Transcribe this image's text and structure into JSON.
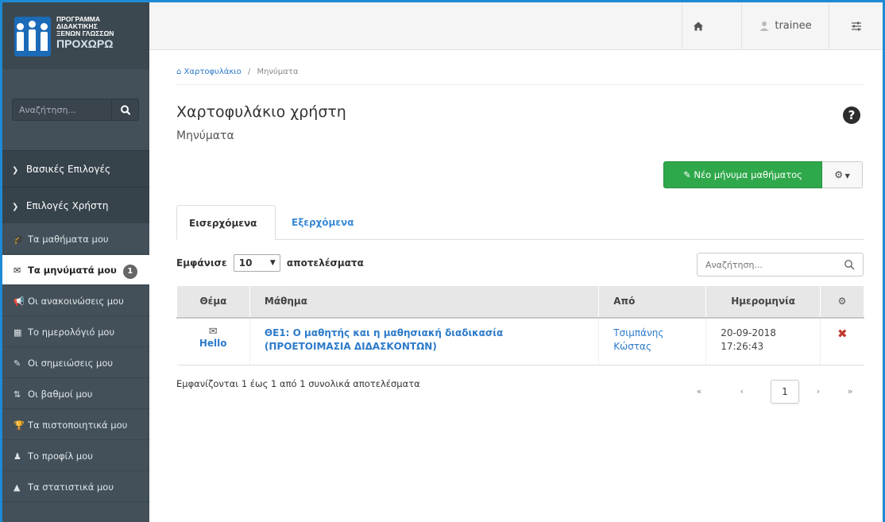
{
  "brand": {
    "line1": "ΠΡΟΓΡΑΜΜΑ",
    "line2": "ΔΙΔΑΚΤΙΚΗΣ",
    "line3": "ΞΕΝΩΝ ΓΛΩΣΣΩΝ",
    "line4": "ΠΡΟΧΩΡΩ"
  },
  "sidebar": {
    "search_placeholder": "Αναζήτηση...",
    "sections": [
      {
        "label": "Βασικές Επιλογές"
      },
      {
        "label": "Επιλογές Χρήστη"
      }
    ],
    "items": [
      {
        "label": "Τα μαθήματα μου",
        "icon": "graduation-cap-icon"
      },
      {
        "label": "Τα μηνύματά μου",
        "icon": "envelope-icon",
        "badge": "1",
        "active": true
      },
      {
        "label": "Οι ανακοινώσεις μου",
        "icon": "bullhorn-icon"
      },
      {
        "label": "Το ημερολόγιό μου",
        "icon": "calendar-icon"
      },
      {
        "label": "Οι σημειώσεις μου",
        "icon": "edit-icon"
      },
      {
        "label": "Οι βαθμοί μου",
        "icon": "sort-numeric-icon"
      },
      {
        "label": "Τα πιστοποιητικά μου",
        "icon": "trophy-icon"
      },
      {
        "label": "Το προφίλ μου",
        "icon": "user-icon"
      },
      {
        "label": "Τα στατιστικά μου",
        "icon": "area-chart-icon"
      }
    ]
  },
  "topbar": {
    "home_icon": "home-icon",
    "user_name": "trainee",
    "settings_icon": "sliders-icon"
  },
  "breadcrumb": {
    "home": "Χαρτοφυλάκιο",
    "separator": "/",
    "current": "Μηνύματα"
  },
  "page": {
    "title": "Χαρτοφυλάκιο χρήστη",
    "subtitle": "Μηνύματα",
    "help": "?"
  },
  "actions": {
    "new_message": "Νέο μήνυμα μαθήματος"
  },
  "tabs": [
    {
      "label": "Εισερχόμενα",
      "active": true
    },
    {
      "label": "Εξερχόμενα",
      "active": false
    }
  ],
  "table_controls": {
    "show_label": "Εμφάνισε",
    "page_size": "10",
    "results_label": "αποτελέσματα",
    "search_placeholder": "Αναζήτηση..."
  },
  "table": {
    "columns": [
      "Θέμα",
      "Μάθημα",
      "Από",
      "Ημερομηνία"
    ],
    "rows": [
      {
        "subject": "Hello",
        "course_line1": "ΘΕ1: Ο μαθητής και η μαθησιακή διαδικασία",
        "course_line2": "(ΠΡΟΕΤΟΙΜΑΣΙΑ ΔΙΔΑΣΚΟΝΤΩΝ)",
        "from_line1": "Τσιμπάνης",
        "from_line2": "Κώστας",
        "date_line1": "20-09-2018",
        "date_line2": "17:26:43"
      }
    ]
  },
  "footer": {
    "info": "Εμφανίζονται 1 έως 1 από 1 συνολικά αποτελέσματα",
    "first": "«",
    "prev": "‹",
    "current_page": "1",
    "next": "›",
    "last": "»"
  },
  "colors": {
    "accent_blue": "#1e8ad6",
    "sidebar_bg": "#43505a",
    "new_button_green": "#2ea84a",
    "delete_red": "#c0392b"
  }
}
